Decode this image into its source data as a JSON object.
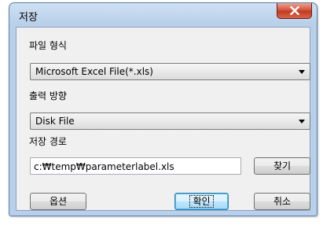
{
  "window": {
    "title": "저장"
  },
  "form": {
    "file_format_label": "파일 형식",
    "file_format_value": "Microsoft Excel File(*.xls)",
    "output_direction_label": "출력 방향",
    "output_direction_value": "Disk File",
    "save_path_label": "저장 경로",
    "save_path_value": "c:₩temp₩parameterlabel.xls"
  },
  "buttons": {
    "browse": "찾기",
    "options": "옵션",
    "ok": "확인",
    "cancel": "취소"
  }
}
